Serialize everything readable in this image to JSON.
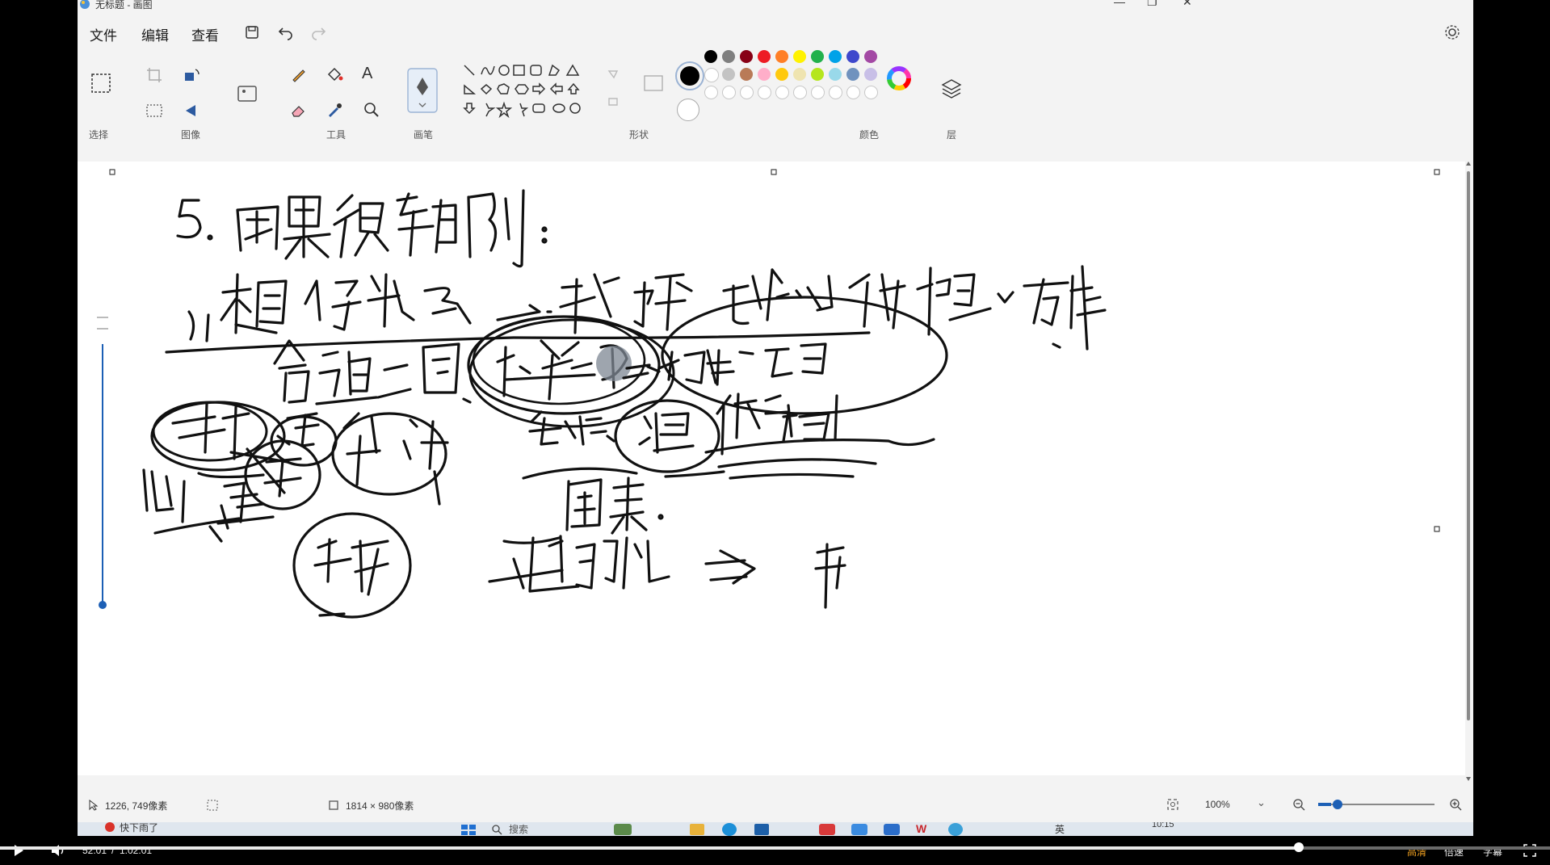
{
  "window": {
    "title": "无标题 - 画图"
  },
  "menu": {
    "file": "文件",
    "edit": "编辑",
    "view": "查看"
  },
  "ribbon": {
    "groups": {
      "select": "选择",
      "image": "图像",
      "tools": "工具",
      "brush": "画笔",
      "shapes": "形状",
      "colors": "颜色",
      "layers": "层"
    }
  },
  "palette": {
    "row1": [
      "#000000",
      "#7f7f7f",
      "#880015",
      "#ed1c24",
      "#ff7f27",
      "#fff200",
      "#22b14c",
      "#00a2e8",
      "#3f48cc",
      "#a349a4"
    ],
    "row2": [
      "#ffffff",
      "#c3c3c3",
      "#b97a57",
      "#ffaec9",
      "#ffc90e",
      "#efe4b0",
      "#b5e61d",
      "#99d9ea",
      "#7092be",
      "#c8bfe7"
    ],
    "primary": "#000000"
  },
  "status": {
    "cursor_pos": "1226, 749像素",
    "canvas_size": "1814 × 980像素",
    "zoom": "100%"
  },
  "taskbar": {
    "notice": "快下雨了",
    "search": "搜索",
    "ime": "英",
    "time": "10:15"
  },
  "player": {
    "current": "52:01",
    "separator": "/",
    "duration": "1:02:01",
    "progress": 0.838,
    "quality": "高清",
    "speed": "倍速",
    "subtitle": "字幕"
  }
}
